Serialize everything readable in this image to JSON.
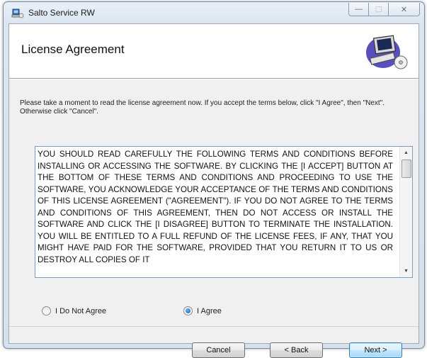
{
  "window": {
    "title": "Salto Service RW",
    "controls": {
      "minimize": "—",
      "maximize": "☐",
      "close": "✕"
    }
  },
  "header": {
    "title": "License Agreement",
    "art_icon": "computer-install-icon"
  },
  "instructions": "Please take a moment to read the license agreement now. If you accept the terms below, click \"I Agree\", then \"Next\". Otherwise click \"Cancel\".",
  "license": {
    "text": "YOU SHOULD READ CAREFULLY THE FOLLOWING TERMS AND CONDITIONS BEFORE INSTALLING OR ACCESSING THE SOFTWARE. BY CLICKING THE [I ACCEPT] BUTTON AT THE BOTTOM OF THESE TERMS AND CONDITIONS AND PROCEEDING TO USE THE SOFTWARE, YOU ACKNOWLEDGE YOUR ACCEPTANCE OF THE TERMS AND CONDITIONS OF THIS LICENSE AGREEMENT (\"AGREEMENT\"). IF YOU DO NOT AGREE TO THE TERMS AND CONDITIONS OF THIS AGREEMENT, THEN DO NOT ACCESS OR INSTALL THE SOFTWARE AND CLICK THE [I DISAGREE] BUTTON TO TERMINATE THE INSTALLATION. YOU WILL BE ENTITLED TO A FULL REFUND OF THE LICENSE FEES, IF ANY, THAT YOU MIGHT HAVE PAID FOR THE SOFTWARE, PROVIDED THAT YOU RETURN IT TO US OR DESTROY ALL COPIES OF IT",
    "scroll_up": "▲",
    "scroll_down": "▼"
  },
  "options": [
    {
      "label": "I Do Not Agree",
      "checked": false
    },
    {
      "label": "I Agree",
      "checked": true
    }
  ],
  "buttons": {
    "cancel": "Cancel",
    "back": "< Back",
    "next": "Next >"
  }
}
